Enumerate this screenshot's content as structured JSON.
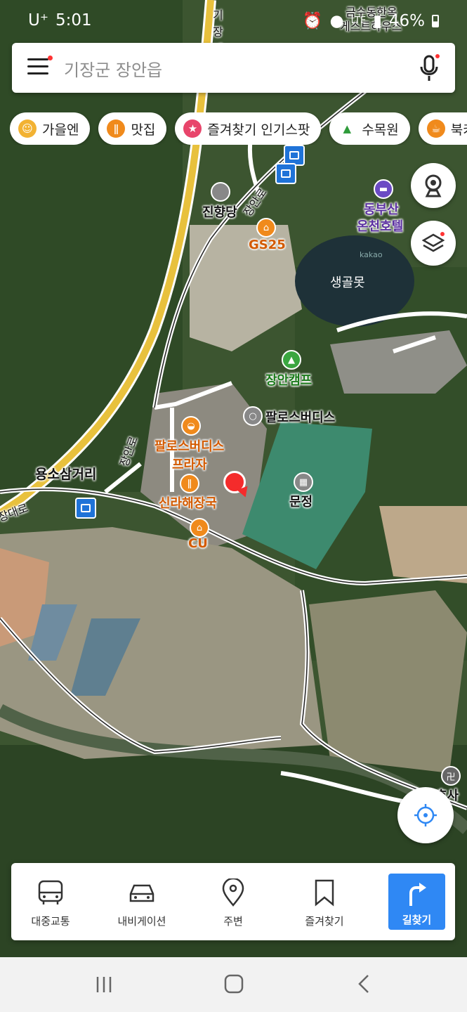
{
  "status": {
    "carrier": "U⁺",
    "time": "5:01",
    "network": "LTE",
    "battery": "46%"
  },
  "search": {
    "placeholder": "기장군 장안읍"
  },
  "chips": [
    {
      "label": "가을엔",
      "icon": "leaf-face-icon",
      "color": "#f2b233"
    },
    {
      "label": "맛집",
      "icon": "fork-knife-icon",
      "color": "#f08a1c"
    },
    {
      "label": "즐겨찾기 인기스팟",
      "icon": "star-icon",
      "color": "#e8456b"
    },
    {
      "label": "수목원",
      "icon": "tree-icon",
      "color": "#2e9b3a"
    },
    {
      "label": "북카",
      "icon": "cup-icon",
      "color": "#f08a1c"
    }
  ],
  "map": {
    "labels": {
      "top_place": "금수동한옥",
      "top_place2": "게스트하우스",
      "road_vertical": "기장대",
      "jinhyangdang": "진향당",
      "jangan_ro": "장안로",
      "gs25": "GS25",
      "dongbusan": "동부산",
      "onchen": "온천호텔",
      "pond": "생골못",
      "camp": "장안캠프",
      "paros": "팔로스버디스",
      "paros_plaza1": "팔로스버디스",
      "paros_plaza2": "프라자",
      "shilla": "신라해장국",
      "cu": "CU",
      "munjeong": "문정",
      "yongso": "용소삼거리",
      "changan_ro2": "장안로",
      "road_left": "장대로",
      "temple": "호사",
      "watermark": "kakao"
    }
  },
  "bottom_tabs": [
    {
      "label": "대중교통",
      "icon": "bus-icon"
    },
    {
      "label": "내비게이션",
      "icon": "car-icon"
    },
    {
      "label": "주변",
      "icon": "location-pin-icon"
    },
    {
      "label": "즐겨찾기",
      "icon": "bookmark-icon"
    }
  ],
  "route_button": {
    "label": "길찾기",
    "icon": "turn-right-arrow-icon",
    "color": "#2f88f4"
  },
  "colors": {
    "accent": "#2f88f4",
    "bus": "#1f73d8",
    "current_location": "#f42b2b"
  }
}
